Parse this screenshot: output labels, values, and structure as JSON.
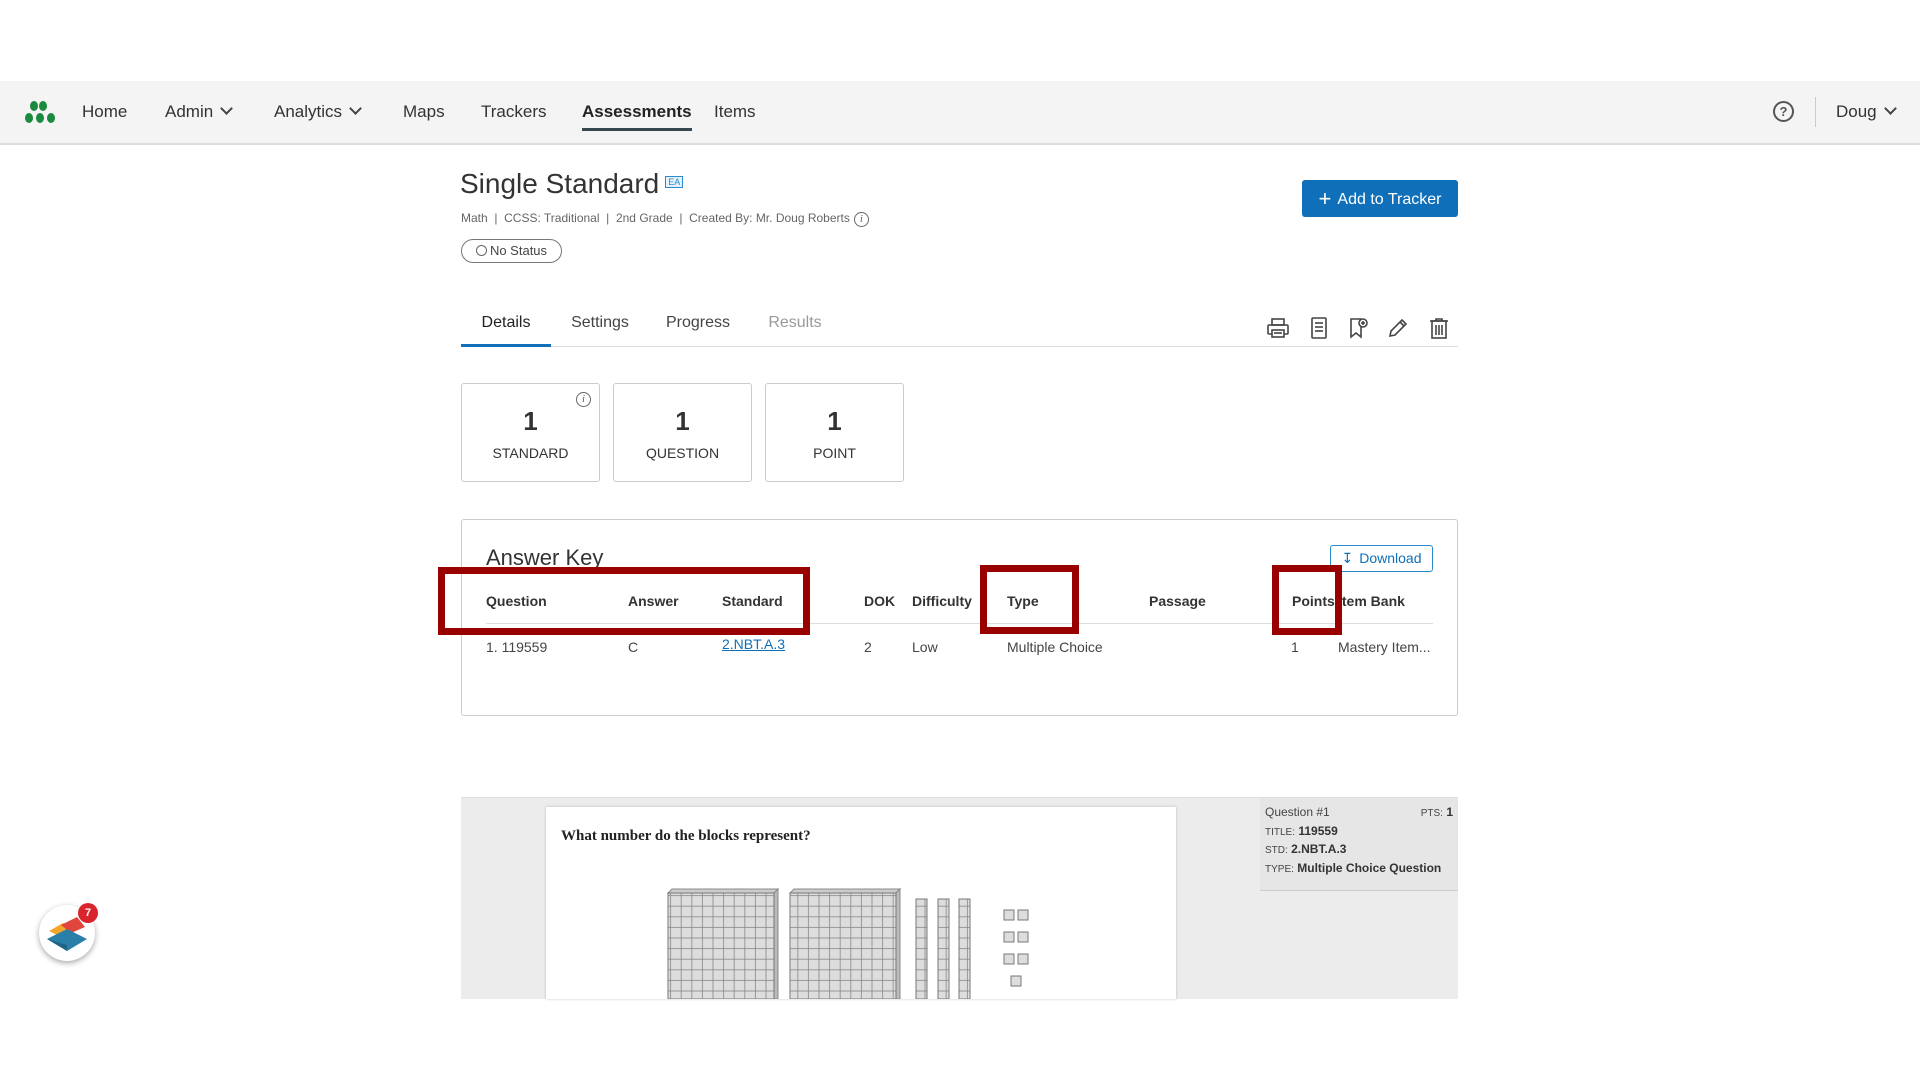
{
  "nav": {
    "items": [
      {
        "label": "Home"
      },
      {
        "label": "Admin"
      },
      {
        "label": "Analytics"
      },
      {
        "label": "Maps"
      },
      {
        "label": "Trackers"
      },
      {
        "label": "Assessments"
      },
      {
        "label": "Items"
      }
    ],
    "user": "Doug"
  },
  "assessment": {
    "title": "Single Standard",
    "badge": "EA",
    "meta": "Math  |  CCSS: Traditional  |  2nd Grade  |  Created By: Mr. Doug Roberts",
    "status": "No Status",
    "add_button": "Add to Tracker"
  },
  "tabs": [
    {
      "label": "Details"
    },
    {
      "label": "Settings"
    },
    {
      "label": "Progress"
    },
    {
      "label": "Results"
    }
  ],
  "stats": [
    {
      "value": "1",
      "label": "STANDARD"
    },
    {
      "value": "1",
      "label": "QUESTION"
    },
    {
      "value": "1",
      "label": "POINT"
    }
  ],
  "answer_key": {
    "title": "Answer Key",
    "download": "Download",
    "columns": [
      "Question",
      "Answer",
      "Standard",
      "DOK",
      "Difficulty",
      "Type",
      "Passage",
      "Points",
      "Item Bank"
    ],
    "rows": [
      {
        "question": "1. 119559",
        "answer": "C",
        "standard": "2.NBT.A.3",
        "dok": "2",
        "difficulty": "Low",
        "type": "Multiple Choice",
        "passage": "",
        "points": "1",
        "item_bank": "Mastery Item..."
      }
    ]
  },
  "preview": {
    "question_text": "What number do the blocks represent?",
    "side": {
      "question": "Question #1",
      "pts_label": "PTS:",
      "pts": "1",
      "title_label": "TITLE:",
      "title": "119559",
      "std_label": "STD:",
      "std": "2.NBT.A.3",
      "type_label": "TYPE:",
      "type": "Multiple Choice Question"
    }
  },
  "widget": {
    "badge_count": "7"
  },
  "colors": {
    "accent": "#0f6fb8",
    "highlight": "#990000",
    "logo": "#1a8a3e"
  }
}
